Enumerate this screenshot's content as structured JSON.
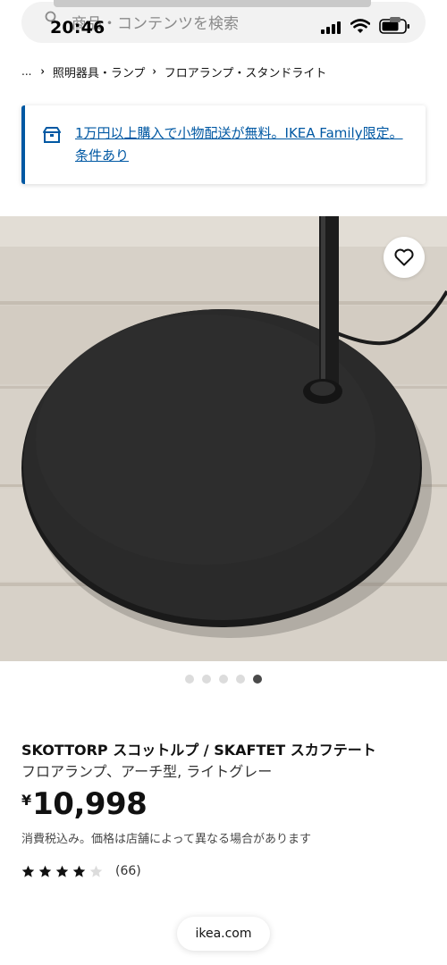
{
  "status_bar": {
    "time": "20:46",
    "signal_icon": "signal-icon",
    "wifi_icon": "wifi-icon",
    "battery_icon": "battery-icon"
  },
  "search": {
    "placeholder": "商品・コンテンツを検索",
    "icon": "search-icon"
  },
  "breadcrumb": {
    "ellipsis": "...",
    "items": [
      {
        "label": "照明器具・ランプ"
      },
      {
        "label": "フロアランプ・スタンドライト"
      }
    ]
  },
  "banner": {
    "icon": "delivery-box-icon",
    "text": "1万円以上購入で小物配送が無料。IKEA Family限定。条件あり",
    "accent_color": "#0058a3"
  },
  "product_image": {
    "favorite_icon": "heart-icon",
    "carousel": {
      "total": 5,
      "active_index": 4
    }
  },
  "product": {
    "name": "SKOTTORP スコットルプ / SKAFTET スカフテート",
    "description": "フロアランプ、アーチ型, ライトグレー",
    "currency": "¥",
    "price": "10,998",
    "tax_note": "消費税込み。価格は店舗によって異なる場合があります",
    "rating": {
      "value": 4,
      "max": 5,
      "reviews": "(66)"
    }
  },
  "browser": {
    "url": "ikea.com"
  }
}
